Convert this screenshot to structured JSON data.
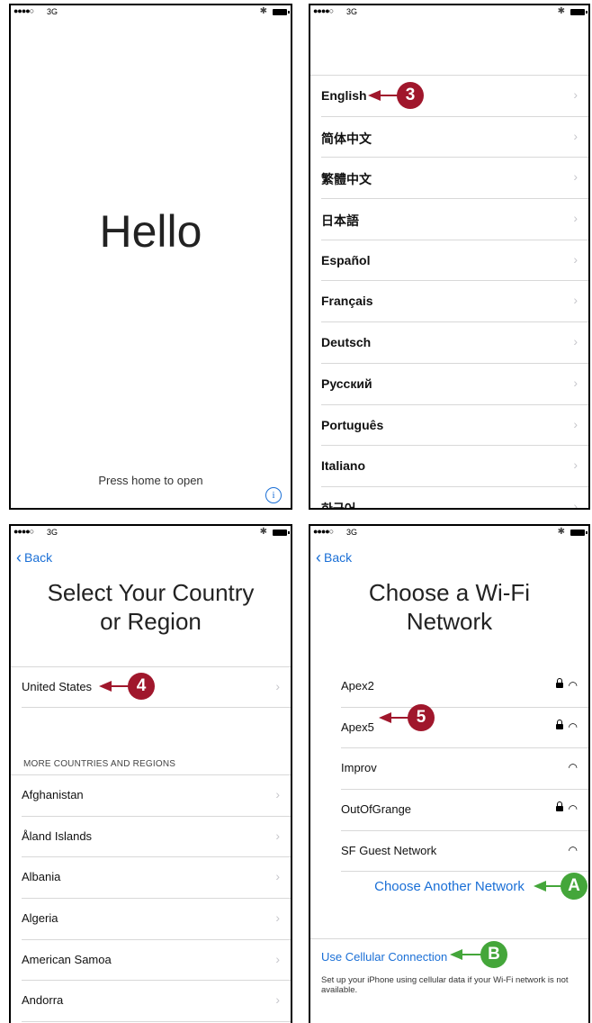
{
  "status": {
    "signal": "●●●●○",
    "network": "3G",
    "bluetooth": "✱"
  },
  "hello": {
    "greeting": "Hello",
    "prompt": "Press home to open",
    "info": "i"
  },
  "language": {
    "items": [
      "English",
      "简体中文",
      "繁體中文",
      "日本語",
      "Español",
      "Français",
      "Deutsch",
      "Русский",
      "Português",
      "Italiano",
      "한국어"
    ],
    "callout": "3"
  },
  "country": {
    "back": "Back",
    "title_line1": "Select Your Country",
    "title_line2": "or Region",
    "top_item": "United States",
    "section_header": "MORE COUNTRIES AND REGIONS",
    "items": [
      "Afghanistan",
      "Åland Islands",
      "Albania",
      "Algeria",
      "American Samoa",
      "Andorra"
    ],
    "callout": "4"
  },
  "wifi": {
    "back": "Back",
    "title_line1": "Choose a Wi-Fi",
    "title_line2": "Network",
    "networks": [
      {
        "name": "Apex2",
        "locked": true
      },
      {
        "name": "Apex5",
        "locked": true
      },
      {
        "name": "Improv",
        "locked": false
      },
      {
        "name": "OutOfGrange",
        "locked": true
      },
      {
        "name": "SF Guest Network",
        "locked": false
      }
    ],
    "another": "Choose Another Network",
    "cellular": "Use Cellular Connection",
    "cellular_note": "Set up your iPhone using cellular data if your Wi-Fi network is not available.",
    "callout_network": "5",
    "callout_another": "A",
    "callout_cellular": "B"
  },
  "colors": {
    "accent": "#1a6fd6",
    "callout_red": "#a0172c",
    "callout_green": "#44a63a"
  }
}
